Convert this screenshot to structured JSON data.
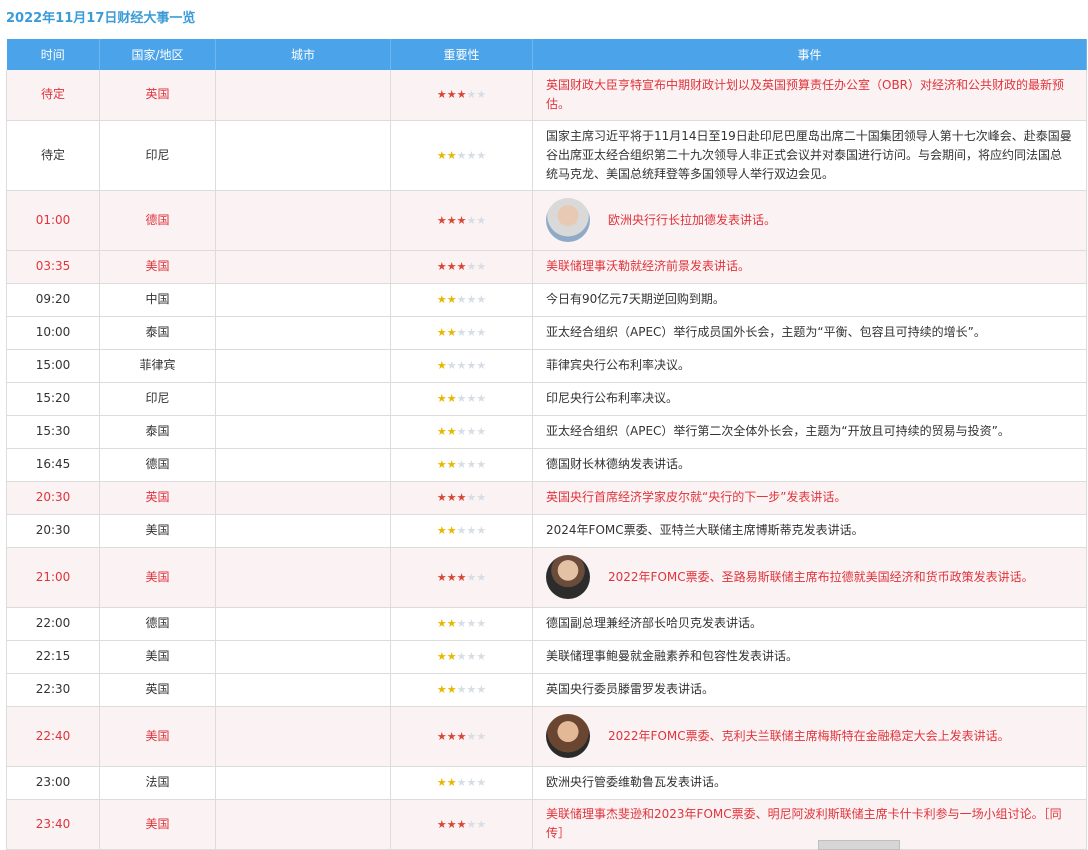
{
  "title": "2022年11月17日财经大事一览",
  "columns": [
    "时间",
    "国家/地区",
    "城市",
    "重要性",
    "事件"
  ],
  "rows": [
    {
      "time": "待定",
      "country": "英国",
      "city": "",
      "stars": 3,
      "event": "英国财政大臣亨特宣布中期财政计划以及英国预算责任办公室（OBR）对经济和公共财政的最新预估。",
      "important": true,
      "avatar": ""
    },
    {
      "time": "待定",
      "country": "印尼",
      "city": "",
      "stars": 2,
      "event": "国家主席习近平将于11月14日至19日赴印尼巴厘岛出席二十国集团领导人第十七次峰会、赴泰国曼谷出席亚太经合组织第二十九次领导人非正式会议并对泰国进行访问。与会期间，将应约同法国总统马克龙、美国总统拜登等多国领导人举行双边会见。",
      "important": false,
      "avatar": ""
    },
    {
      "time": "01:00",
      "country": "德国",
      "city": "",
      "stars": 3,
      "event": "欧洲央行行长拉加德发表讲话。",
      "important": true,
      "avatar": "lagarde"
    },
    {
      "time": "03:35",
      "country": "美国",
      "city": "",
      "stars": 3,
      "event": "美联储理事沃勒就经济前景发表讲话。",
      "important": true,
      "avatar": ""
    },
    {
      "time": "09:20",
      "country": "中国",
      "city": "",
      "stars": 2,
      "event": "今日有90亿元7天期逆回购到期。",
      "important": false,
      "avatar": ""
    },
    {
      "time": "10:00",
      "country": "泰国",
      "city": "",
      "stars": 2,
      "event": "亚太经合组织（APEC）举行成员国外长会，主题为“平衡、包容且可持续的增长”。",
      "important": false,
      "avatar": ""
    },
    {
      "time": "15:00",
      "country": "菲律宾",
      "city": "",
      "stars": 1,
      "event": "菲律宾央行公布利率决议。",
      "important": false,
      "avatar": ""
    },
    {
      "time": "15:20",
      "country": "印尼",
      "city": "",
      "stars": 2,
      "event": "印尼央行公布利率决议。",
      "important": false,
      "avatar": ""
    },
    {
      "time": "15:30",
      "country": "泰国",
      "city": "",
      "stars": 2,
      "event": "亚太经合组织（APEC）举行第二次全体外长会，主题为“开放且可持续的贸易与投资”。",
      "important": false,
      "avatar": ""
    },
    {
      "time": "16:45",
      "country": "德国",
      "city": "",
      "stars": 2,
      "event": "德国财长林德纳发表讲话。",
      "important": false,
      "avatar": ""
    },
    {
      "time": "20:30",
      "country": "英国",
      "city": "",
      "stars": 3,
      "event": "英国央行首席经济学家皮尔就“央行的下一步”发表讲话。",
      "important": true,
      "avatar": ""
    },
    {
      "time": "20:30",
      "country": "美国",
      "city": "",
      "stars": 2,
      "event": "2024年FOMC票委、亚特兰大联储主席博斯蒂克发表讲话。",
      "important": false,
      "avatar": ""
    },
    {
      "time": "21:00",
      "country": "美国",
      "city": "",
      "stars": 3,
      "event": "2022年FOMC票委、圣路易斯联储主席布拉德就美国经济和货币政策发表讲话。",
      "important": true,
      "avatar": "bullard"
    },
    {
      "time": "22:00",
      "country": "德国",
      "city": "",
      "stars": 2,
      "event": "德国副总理兼经济部长哈贝克发表讲话。",
      "important": false,
      "avatar": ""
    },
    {
      "time": "22:15",
      "country": "美国",
      "city": "",
      "stars": 2,
      "event": "美联储理事鲍曼就金融素养和包容性发表讲话。",
      "important": false,
      "avatar": ""
    },
    {
      "time": "22:30",
      "country": "英国",
      "city": "",
      "stars": 2,
      "event": "英国央行委员滕雷罗发表讲话。",
      "important": false,
      "avatar": ""
    },
    {
      "time": "22:40",
      "country": "美国",
      "city": "",
      "stars": 3,
      "event": "2022年FOMC票委、克利夫兰联储主席梅斯特在金融稳定大会上发表讲话。",
      "important": true,
      "avatar": "mester"
    },
    {
      "time": "23:00",
      "country": "法国",
      "city": "",
      "stars": 2,
      "event": "欧洲央行管委维勒鲁瓦发表讲话。",
      "important": false,
      "avatar": ""
    },
    {
      "time": "23:40",
      "country": "美国",
      "city": "",
      "stars": 3,
      "event": "美联储理事杰斐逊和2023年FOMC票委、明尼阿波利斯联储主席卡什卡利参与一场小组讨论。［同传］",
      "important": true,
      "avatar": ""
    }
  ],
  "colors": {
    "header_bg": "#4ba3ea",
    "important_text": "#e0343c",
    "important_bg": "#fbf3f3",
    "star_red": "#d94636",
    "star_gold": "#e6b800",
    "star_empty": "#d7dde4"
  }
}
